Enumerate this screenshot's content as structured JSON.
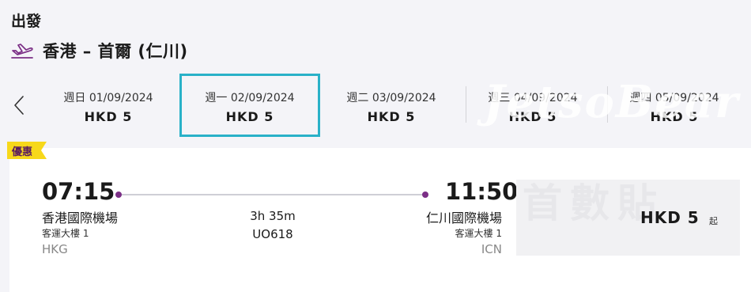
{
  "header": {
    "section_title": "出發",
    "route": "香港 – 首爾 (仁川)"
  },
  "dates": [
    {
      "label": "週日 01/09/2024",
      "price": "HKD  5",
      "selected": false
    },
    {
      "label": "週一 02/09/2024",
      "price": "HKD  5",
      "selected": true
    },
    {
      "label": "週二 03/09/2024",
      "price": "HKD  5",
      "selected": false
    },
    {
      "label": "週三 04/09/2024",
      "price": "HKD  5",
      "selected": false
    },
    {
      "label": "週四 05/09/2024",
      "price": "HKD  5",
      "selected": false
    }
  ],
  "watermark": "JetsoBear",
  "flight": {
    "badge": "優惠",
    "departure": {
      "time": "07:15",
      "airport": "香港國際機場",
      "terminal": "客運大樓 1",
      "code": "HKG"
    },
    "arrival": {
      "time": "11:50",
      "airport": "仁川國際機場",
      "terminal": "客運大樓 1",
      "code": "ICN"
    },
    "duration": "3h 35m",
    "flight_number": "UO618",
    "price": "HKD  5",
    "price_suffix": "起",
    "price_watermark": "首數貼"
  },
  "colors": {
    "accent_purple": "#7b2f86",
    "selected_border": "#29b1c8",
    "badge_yellow": "#f7d81a"
  },
  "icons": {
    "route": "plane-takeoff-icon",
    "prev": "chevron-left-icon"
  }
}
